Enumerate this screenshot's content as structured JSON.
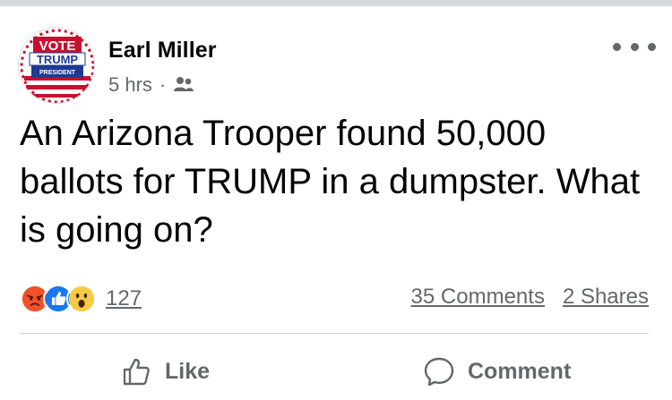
{
  "post": {
    "author": "Earl Miller",
    "time": "5 hrs",
    "separator": "·",
    "audience_icon": "friends-icon",
    "text": "An Arizona Trooper found 50,000 ballots for TRUMP in a dumpster. What is going on?"
  },
  "avatar": {
    "line1": "VOTE",
    "line2": "TRUMP",
    "line3": "PRESIDENT",
    "colors": {
      "red": "#c8102e",
      "blue": "#1f3a93",
      "white": "#ffffff"
    }
  },
  "reactions": {
    "icons": [
      "angry-icon",
      "like-icon",
      "wow-icon"
    ],
    "count": "127"
  },
  "stats": {
    "comments": "35 Comments",
    "shares": "2 Shares"
  },
  "actions": {
    "like": "Like",
    "comment": "Comment"
  },
  "colors": {
    "secondary_text": "#65676b",
    "like_blue": "#1877f2",
    "angry_orange": "#f0502a",
    "wow_yellow": "#f7c945"
  }
}
